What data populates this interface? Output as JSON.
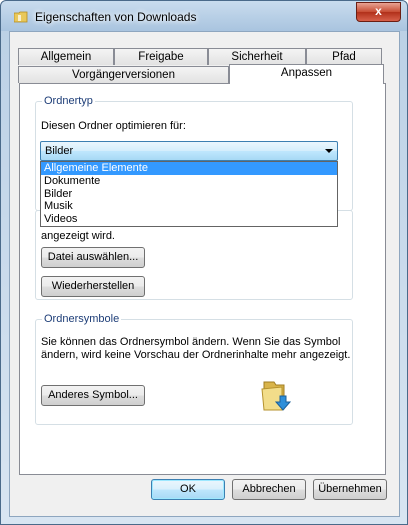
{
  "window": {
    "title": "Eigenschaften von Downloads",
    "close_label": "x"
  },
  "tabs_row1": [
    "Allgemein",
    "Freigabe",
    "Sicherheit",
    "Pfad"
  ],
  "tabs_row2": [
    "Vorgängerversionen",
    "Anpassen"
  ],
  "active_tab": "Anpassen",
  "ordnertyp": {
    "legend": "Ordnertyp",
    "prompt": "Diesen Ordner optimieren für:",
    "selected": "Bilder",
    "options": [
      "Allgemeine Elemente",
      "Dokumente",
      "Bilder",
      "Musik",
      "Videos"
    ],
    "highlighted_option": "Allgemeine Elemente"
  },
  "ordnerbilder": {
    "partial_text": "angezeigt wird.",
    "choose_file_button": "Datei auswählen...",
    "restore_button": "Wiederherstellen"
  },
  "ordnersymbole": {
    "legend": "Ordnersymbole",
    "description_line1": "Sie können das Ordnersymbol ändern. Wenn Sie das Symbol",
    "description_line2": "ändern, wird keine Vorschau der Ordnerinhalte mehr angezeigt.",
    "change_icon_button": "Anderes Symbol..."
  },
  "footer": {
    "ok": "OK",
    "cancel": "Abbrechen",
    "apply": "Übernehmen"
  },
  "colors": {
    "selection": "#3399ff",
    "legend_text": "#1e3e78"
  }
}
